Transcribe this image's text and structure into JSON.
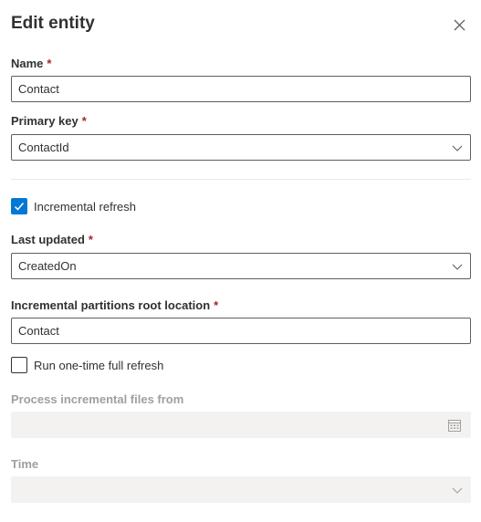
{
  "panel": {
    "title": "Edit entity",
    "close_icon": "close-icon"
  },
  "required_marker": "*",
  "name": {
    "label": "Name",
    "value": "Contact"
  },
  "primary_key": {
    "label": "Primary key",
    "value": "ContactId",
    "icon": "chevron-down-icon"
  },
  "incremental_refresh": {
    "label": "Incremental refresh",
    "checked": true
  },
  "last_updated": {
    "label": "Last updated",
    "value": "CreatedOn",
    "icon": "chevron-down-icon"
  },
  "partitions_root": {
    "label": "Incremental partitions root location",
    "value": "Contact"
  },
  "full_refresh": {
    "label": "Run one-time full refresh",
    "checked": false
  },
  "process_from": {
    "label": "Process incremental files from",
    "value": "",
    "icon": "calendar-icon",
    "disabled": true
  },
  "time": {
    "label": "Time",
    "value": "",
    "icon": "chevron-down-icon",
    "disabled": true
  },
  "colors": {
    "accent": "#0078d4",
    "required": "#a4262c",
    "text": "#323130",
    "disabled_text": "#a19f9d",
    "disabled_field": "#f3f2f1",
    "border": "#605e5c"
  }
}
